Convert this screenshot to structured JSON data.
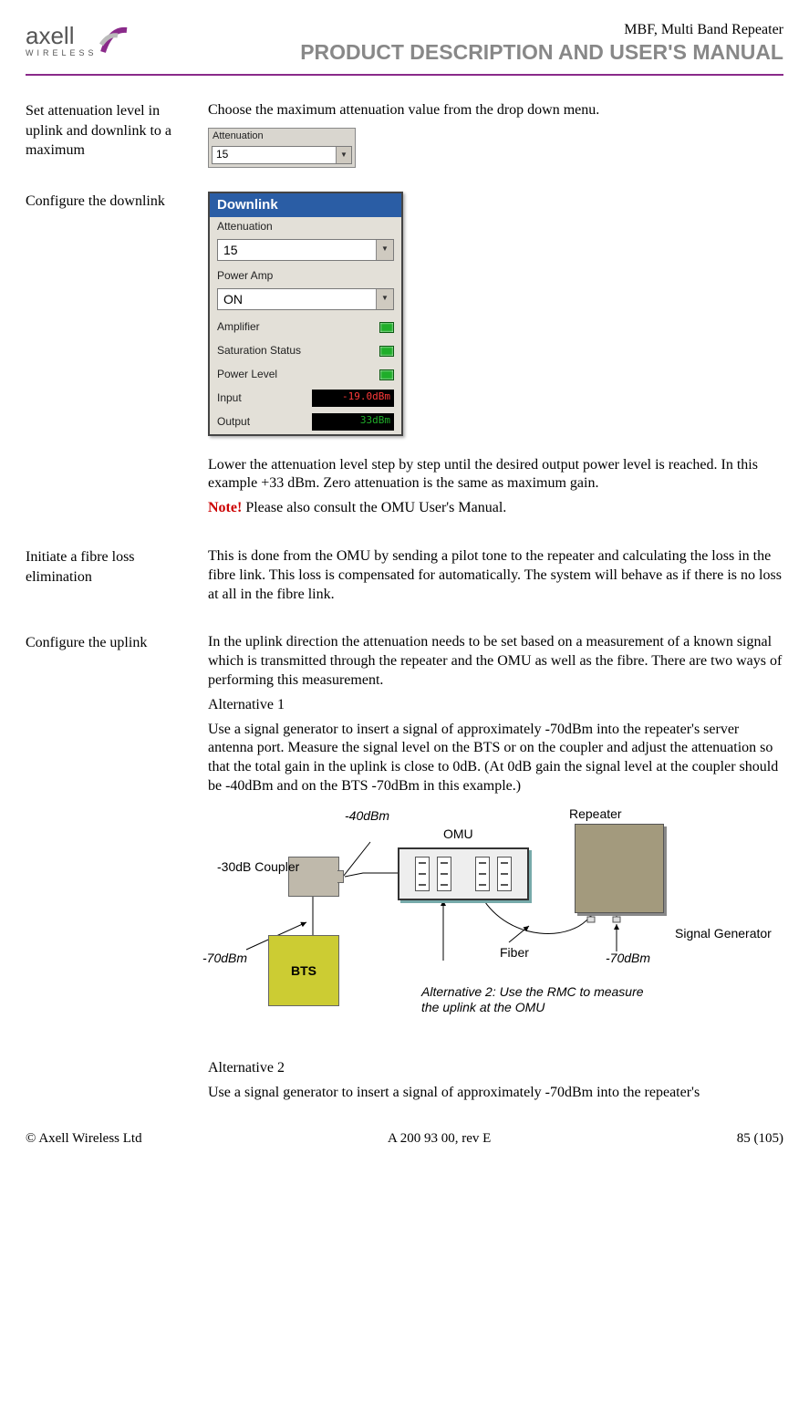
{
  "header": {
    "logo_main": "axell",
    "logo_sub": "WIRELESS",
    "small_title": "MBF, Multi Band Repeater",
    "big_title": "PRODUCT DESCRIPTION AND USER'S MANUAL"
  },
  "sections": {
    "attenuation": {
      "side": "Set attenuation level in uplink and downlink to a maximum",
      "body": "Choose the maximum attenuation value from the drop down menu.",
      "fig_label": "Attenuation",
      "fig_value": "15"
    },
    "downlink_cfg": {
      "side": "Configure the downlink",
      "panel_title": "Downlink",
      "atten_label": "Attenuation",
      "atten_value": "15",
      "poweramp_label": "Power Amp",
      "poweramp_value": "ON",
      "amp_label": "Amplifier",
      "sat_label": "Saturation Status",
      "pl_label": "Power Level",
      "input_label": "Input",
      "input_value": "-19.0dBm",
      "output_label": "Output",
      "output_value": "33dBm",
      "body1": "Lower the attenuation level step by step until the desired output power level is reached. In this example +33 dBm. Zero attenuation is the same as maximum gain.",
      "note_label": "Note!",
      "note_body": " Please also consult the OMU User's Manual."
    },
    "fibre": {
      "side": "Initiate a fibre loss elimination",
      "body": "This is done from the OMU by sending a pilot tone to the repeater and calculating the loss in the fibre link. This loss is compensated for automatically. The system will behave as if there is no loss at all in the fibre link."
    },
    "uplink": {
      "side": "Configure the uplink",
      "p1": "In the uplink direction the attenuation needs to be set based on a measurement of a known signal which is transmitted through the repeater and the OMU as well as the fibre. There are two ways of performing this measurement.",
      "alt1_head": "Alternative 1",
      "alt1_body": "Use a signal generator to insert a signal of approximately -70dBm into the repeater's server antenna port. Measure the signal level on the BTS or on the coupler and adjust the attenuation so that the total gain in the uplink is close to 0dB. (At 0dB gain the signal level at the coupler should be -40dBm and on the BTS -70dBm in this example.)",
      "diagram": {
        "coupler_label": "-30dB Coupler",
        "bts_label": "BTS",
        "omu_label": "OMU",
        "repeater_label": "Repeater",
        "sig_label": "Signal Generator",
        "fiber_label": "Fiber",
        "m40": "-40dBm",
        "m70_left": "-70dBm",
        "m70_right": "-70dBm",
        "alt2_note": "Alternative 2: Use the RMC to measure the uplink at the OMU"
      },
      "alt2_head": "Alternative 2",
      "alt2_body": "Use a signal generator to insert a signal of approximately -70dBm into the repeater's"
    }
  },
  "footer": {
    "left": "© Axell Wireless Ltd",
    "center": "A 200 93 00, rev E",
    "right": "85 (105)"
  }
}
